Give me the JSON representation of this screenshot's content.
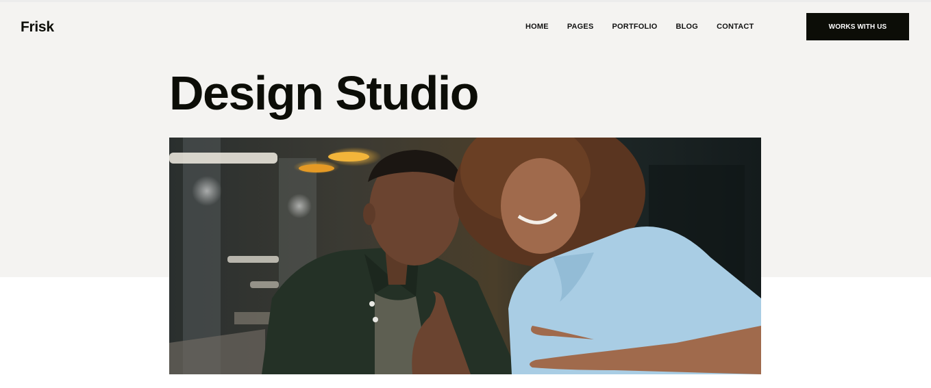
{
  "brand": {
    "logo_text": "Frisk"
  },
  "nav": {
    "items": [
      {
        "label": "HOME"
      },
      {
        "label": "PAGES"
      },
      {
        "label": "PORTFOLIO"
      },
      {
        "label": "BLOG"
      },
      {
        "label": "CONTACT"
      }
    ]
  },
  "cta": {
    "label": "WORKS WITH US"
  },
  "hero": {
    "title": "Design Studio",
    "image_description_icon": "photo-two-people-looking-at-screen"
  },
  "colors": {
    "hero_background": "#f4f3f1",
    "text_dark": "#0c0d07",
    "button_bg": "#0c0d07",
    "button_text": "#ffffff"
  }
}
